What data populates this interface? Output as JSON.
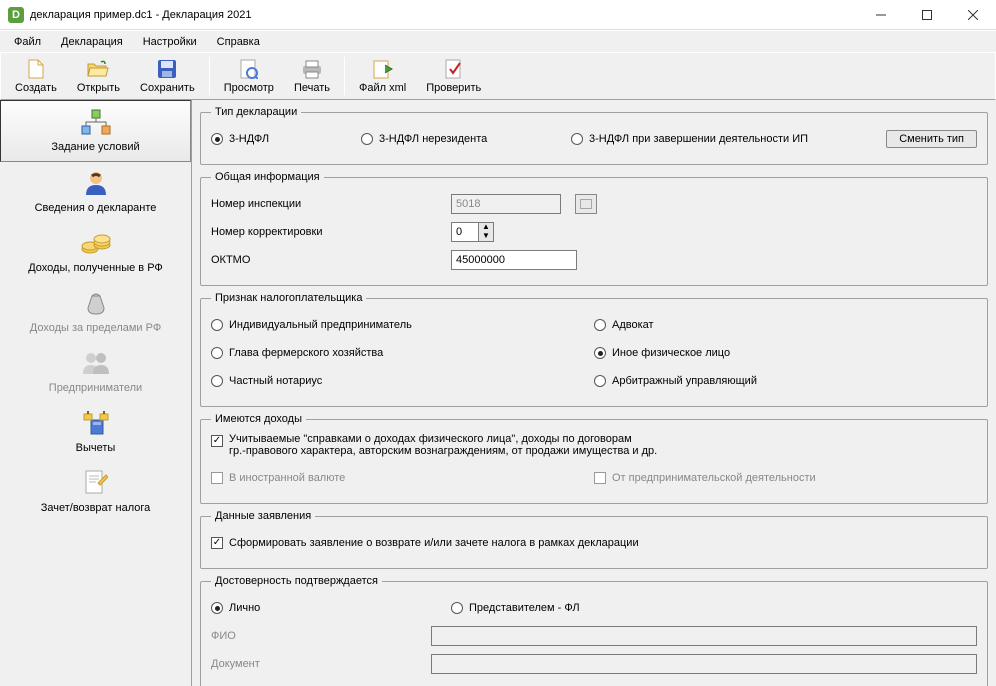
{
  "window": {
    "title": "декларация пример.dc1 - Декларация 2021"
  },
  "menu": {
    "file": "Файл",
    "decl": "Декларация",
    "settings": "Настройки",
    "help": "Справка"
  },
  "toolbar": {
    "create": "Создать",
    "open": "Открыть",
    "save": "Сохранить",
    "preview": "Просмотр",
    "print": "Печать",
    "xml": "Файл xml",
    "check": "Проверить"
  },
  "sidebar": {
    "items": [
      {
        "label": "Задание условий"
      },
      {
        "label": "Сведения о декларанте"
      },
      {
        "label": "Доходы, полученные в РФ"
      },
      {
        "label": "Доходы за пределами РФ"
      },
      {
        "label": "Предприниматели"
      },
      {
        "label": "Вычеты"
      },
      {
        "label": "Зачет/возврат налога"
      }
    ]
  },
  "declType": {
    "legend": "Тип декларации",
    "opt1": "3-НДФЛ",
    "opt2": "3-НДФЛ нерезидента",
    "opt3": "3-НДФЛ при завершении деятельности ИП",
    "change": "Сменить тип"
  },
  "general": {
    "legend": "Общая информация",
    "inspLabel": "Номер инспекции",
    "inspValue": "5018",
    "corrLabel": "Номер корректировки",
    "corrValue": "0",
    "oktmoLabel": "ОКТМО",
    "oktmoValue": "45000000"
  },
  "taxpayer": {
    "legend": "Признак налогоплательщика",
    "ip": "Индивидуальный предприниматель",
    "adv": "Адвокат",
    "farm": "Глава фермерского хозяйства",
    "other": "Иное физическое лицо",
    "not": "Частный нотариус",
    "arb": "Арбитражный управляющий"
  },
  "income": {
    "legend": "Имеются доходы",
    "c1a": "Учитываемые \"справками о доходах физического лица\", доходы по договорам",
    "c1b": "гр.-правового характера, авторским вознаграждениям, от продажи имущества и др.",
    "c2": "В иностранной валюте",
    "c3": "От предпринимательской деятельности"
  },
  "appl": {
    "legend": "Данные заявления",
    "c1": "Сформировать заявление о  возврате и/или зачете налога в рамках декларации"
  },
  "trust": {
    "legend": "Достоверность подтверждается",
    "self": "Лично",
    "rep": "Представителем - ФЛ",
    "fio": "ФИО",
    "doc": "Документ"
  }
}
